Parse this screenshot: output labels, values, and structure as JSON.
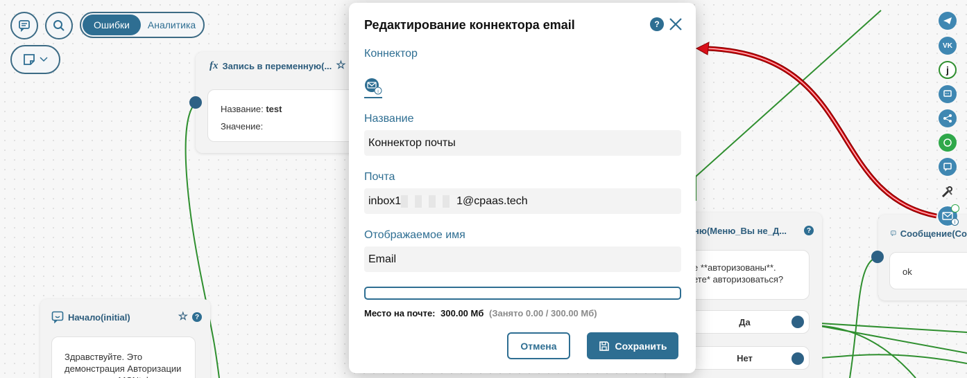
{
  "toolbar": {
    "tab_errors": "Ошибки",
    "tab_analytics": "Аналитика"
  },
  "nodes": {
    "variable": {
      "title": "Запись в переменную(...",
      "name_label": "Название:",
      "name_value": "test",
      "value_label": "Значение:"
    },
    "start": {
      "title": "Начало(initial)",
      "text": "Здравствуйте. Это демонстрация Авторизации по звонку от MCNtelecom"
    },
    "menu": {
      "title": "ню(Меню_Вы не_Д...",
      "line1": "е **авторизованы**.",
      "line2": "ете* авторизоваться?",
      "option_yes": "Да",
      "option_no": "Нет"
    },
    "message": {
      "title": "Сообщение(Со",
      "text": "ok"
    }
  },
  "channels": [
    "telegram-icon",
    "vk-icon",
    "jivo-icon",
    "chat-icon",
    "share-icon",
    "whatsapp-icon",
    "sms-icon",
    "tools-icon",
    "email-icon"
  ],
  "modal": {
    "title": "Редактирование коннектора email",
    "help": "?",
    "connector_label": "Коннектор",
    "name_label": "Название",
    "name_value": "Коннектор почты",
    "email_label": "Почта",
    "email_prefix": "inbox1",
    "email_suffix": "1@cpaas.tech",
    "display_label": "Отображаемое имя",
    "display_value": "Email",
    "storage_label": "Место на почте:",
    "storage_value": "300.00 Мб",
    "storage_used": "(Занято 0.00 / 300.00 Мб)",
    "storage_fraction": 0,
    "cancel": "Отмена",
    "save": "Сохранить"
  },
  "colors": {
    "accent": "#2e6e92",
    "flow_line": "#2f8f2f",
    "arrow": "#e0101a"
  }
}
